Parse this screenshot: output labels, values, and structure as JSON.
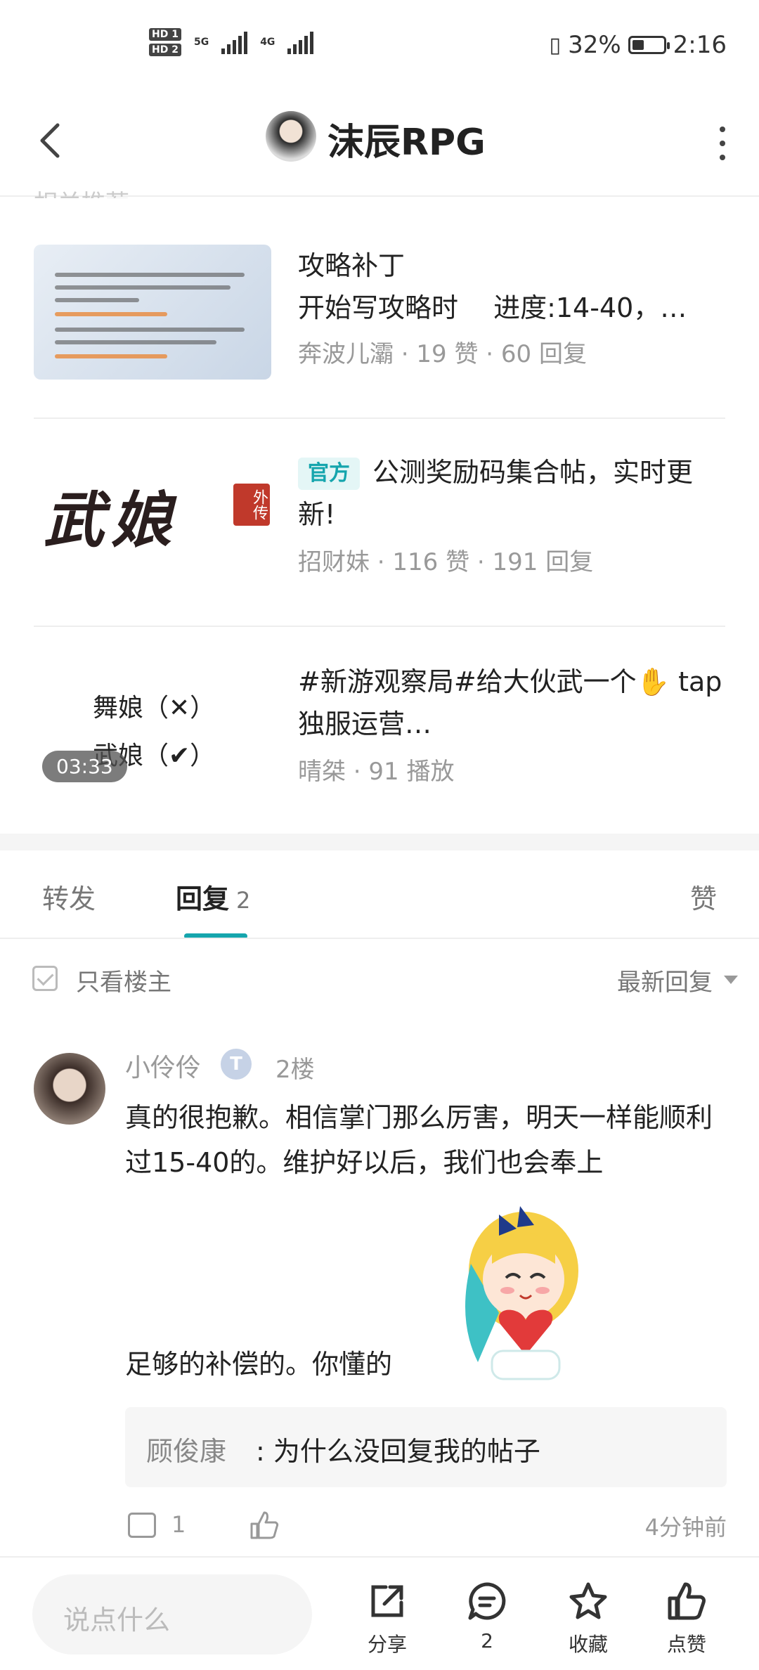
{
  "status_bar": {
    "hd1": "HD 1",
    "hd2": "HD 2",
    "net1": "5G",
    "net2": "4G",
    "battery": "32%",
    "time": "2:16"
  },
  "header": {
    "title": "沫辰RPG"
  },
  "section_cut_title": "相关推荐",
  "recommendations": [
    {
      "title_line1": "攻略补丁",
      "title_line2": "开始写攻略时　 进度:14-40，…",
      "meta": "奔波儿灞 · 19 赞 · 60 回复"
    },
    {
      "tag": "官方",
      "title": "公测奖励码集合帖，实时更新!",
      "meta": "招财妹 · 116 赞 · 191 回复",
      "logo_text": "武娘",
      "logo_seal": "外传"
    },
    {
      "title": "#新游观察局#给大伙武一个✋ tap独服运营…",
      "meta": "晴桀 · 91 播放",
      "thumb_line1": "舞娘（✕）",
      "thumb_line2": "武娘（✔）",
      "duration": "03:33"
    }
  ],
  "tabs": {
    "forward": "转发",
    "reply": "回复",
    "reply_count": "2",
    "like": "赞"
  },
  "filter": {
    "only_op": "只看楼主",
    "sort": "最新回复"
  },
  "reply": {
    "name": "小伶伶",
    "badge": "T",
    "floor": "2楼",
    "text": "真的很抱歉。相信掌门那么厉害，明天一样能顺利过15-40的。维护好以后，我们也会奉上",
    "text_tail": "足够的补偿的。你懂的",
    "quote_name": "顾俊康",
    "quote_text": ": 为什么没回复我的帖子",
    "comment_count": "1",
    "time": "4分钟前"
  },
  "bottom_bar": {
    "input_placeholder": "说点什么",
    "share": "分享",
    "comments": "2",
    "favorite": "收藏",
    "like": "点赞"
  }
}
